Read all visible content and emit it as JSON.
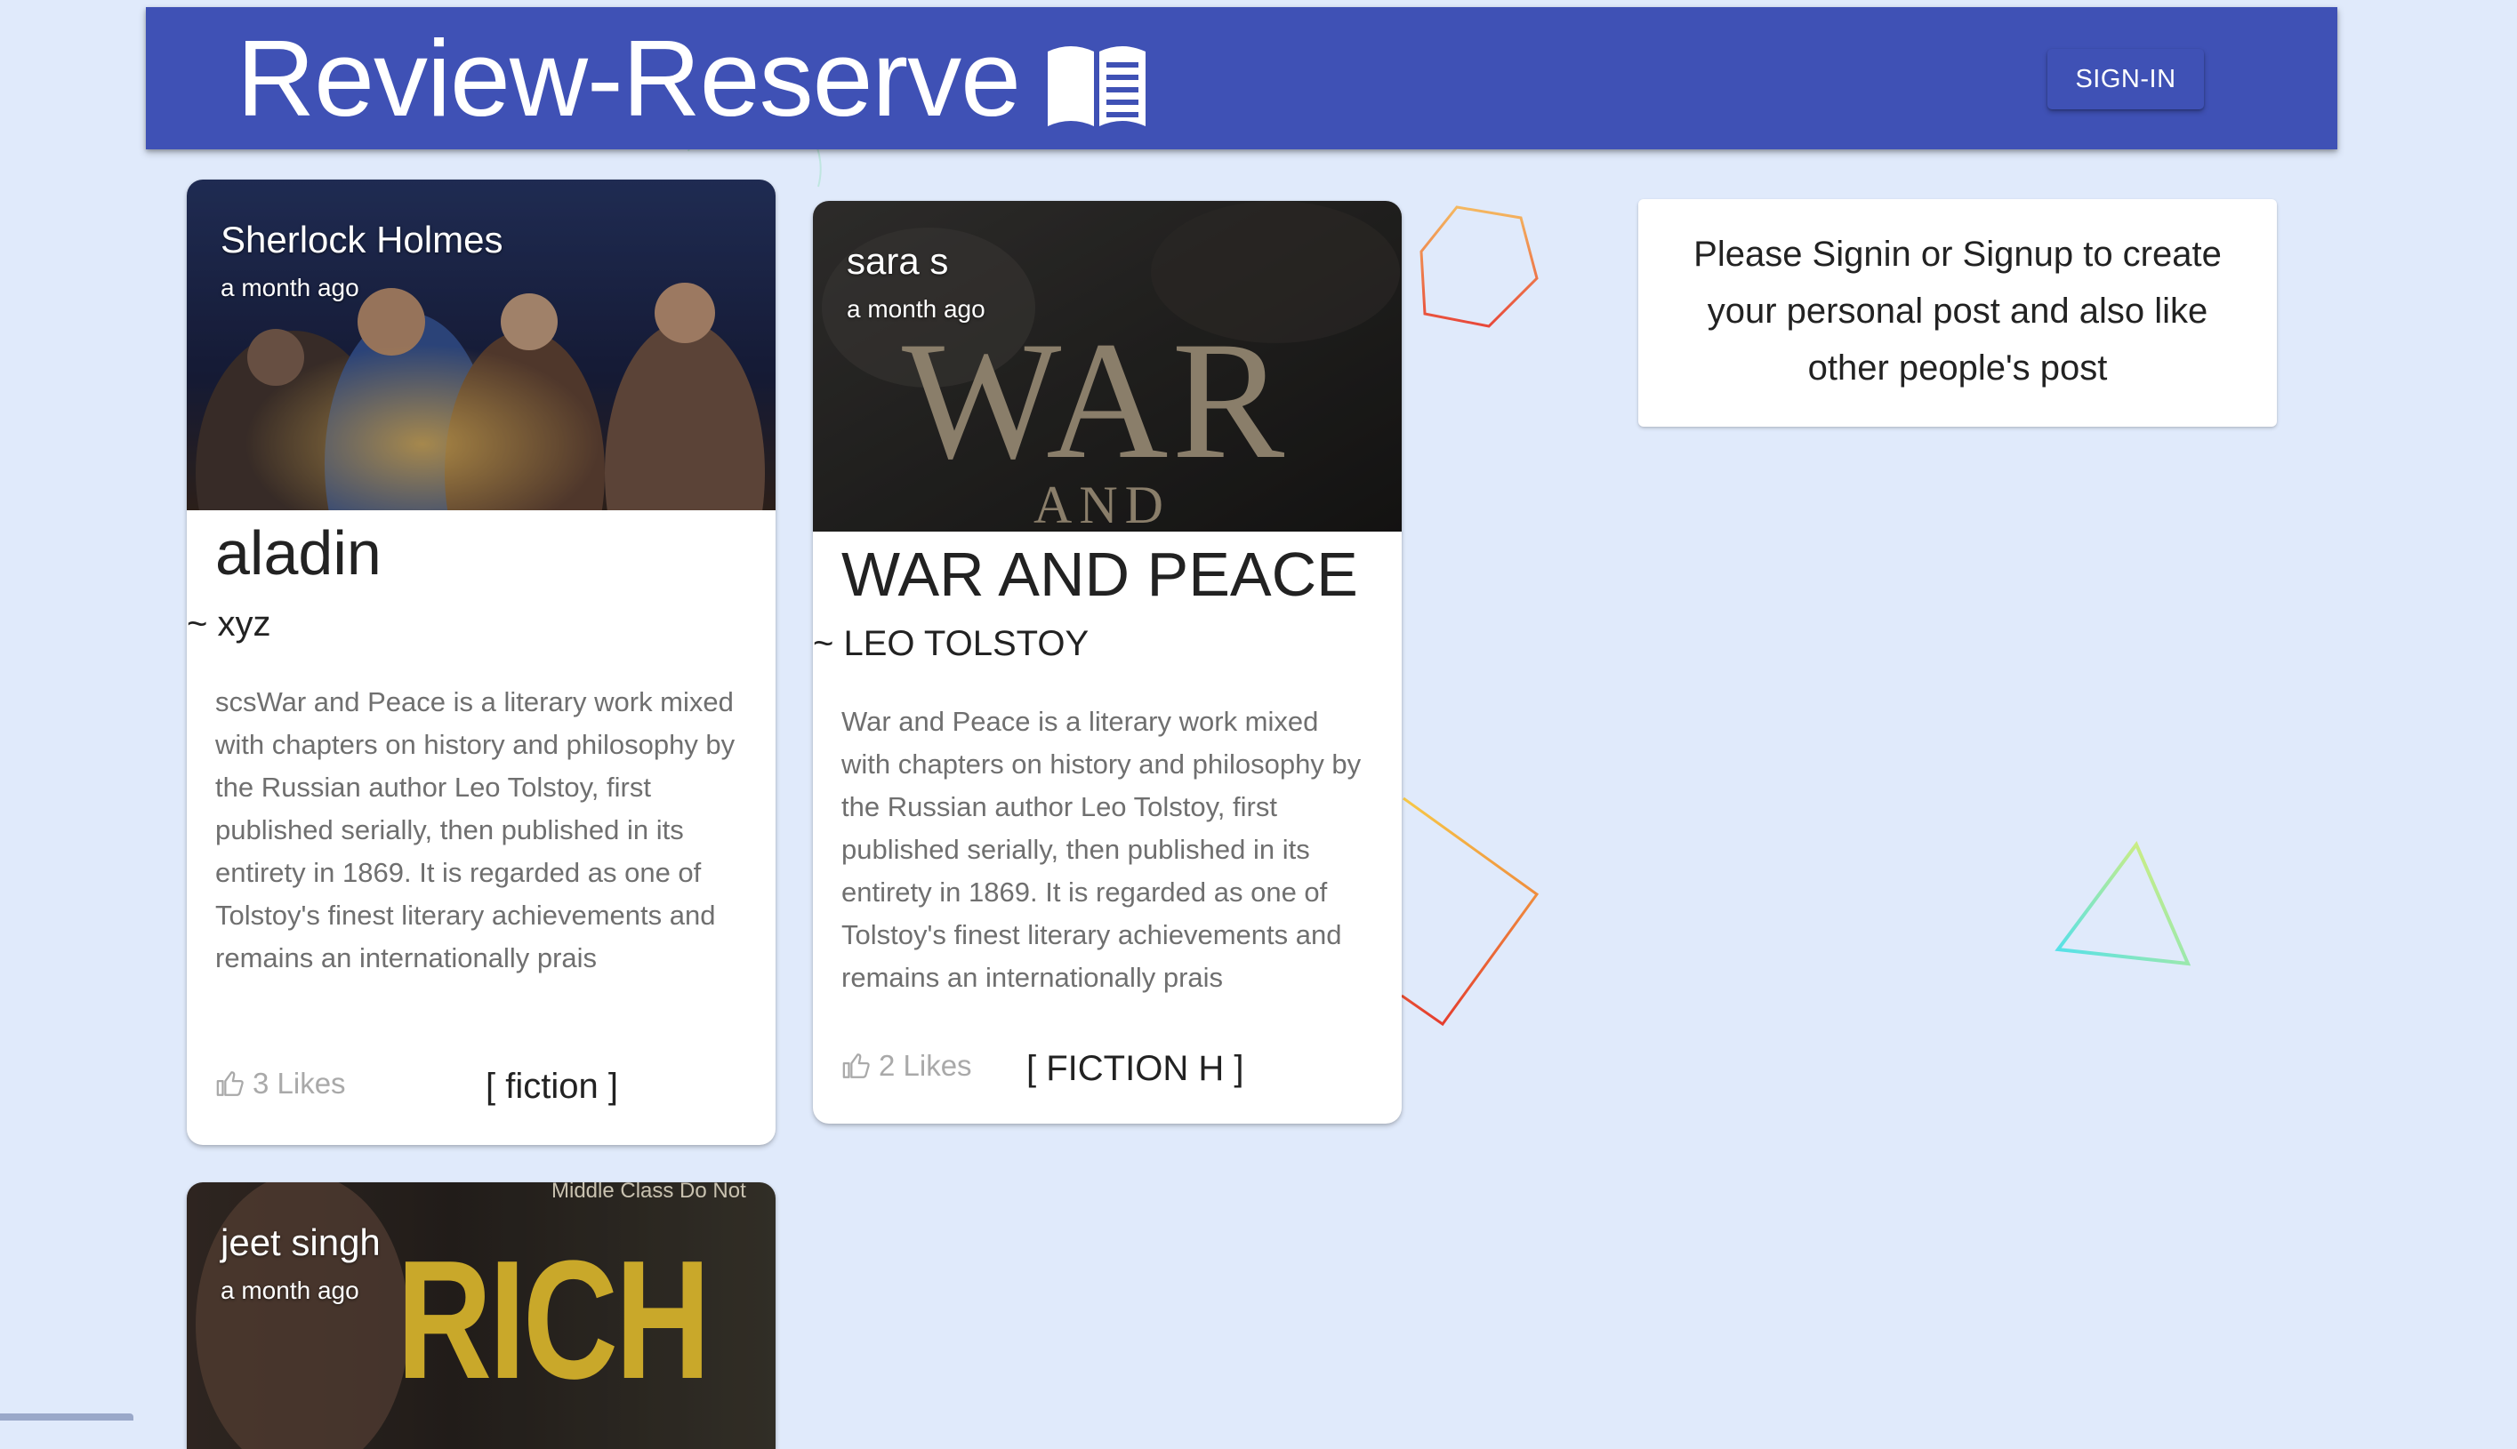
{
  "header": {
    "title": "Review-Reserve",
    "book_icon": "open-book-icon",
    "signin_label": "SIGN-IN",
    "background": "#3f51b5"
  },
  "posts": [
    {
      "author": "Sherlock Holmes",
      "time": "a month ago",
      "title": "aladin",
      "book_author": "~ xyz",
      "excerpt": "scsWar and Peace is a literary work mixed with chapters on history and philosophy by the Russian author Leo Tolstoy, first published serially, then published in its entirety in 1869. It is regarded as one of Tolstoy's finest literary achievements and remains an internationally prais",
      "likes": "3 Likes",
      "genre": "[ fiction ]"
    },
    {
      "author": "sara s",
      "time": "a month ago",
      "cover_text_1": "WAR",
      "cover_text_2": "AND",
      "title": "WAR AND PEACE",
      "book_author": "~ LEO TOLSTOY",
      "excerpt": "War and Peace is a literary work mixed with chapters on history and philosophy by the Russian author Leo Tolstoy, first published serially, then published in its entirety in 1869. It is regarded as one of Tolstoy's finest literary achievements and remains an internationally prais",
      "likes": "2 Likes",
      "genre": "[ FICTION H ]"
    },
    {
      "author": "jeet singh",
      "time": "a month ago",
      "cover_text_top": "Middle Class Do Not",
      "cover_text_big": "RICH"
    }
  ],
  "notice": {
    "text": "Please Signin or Signup to create your personal post and also like other people's post"
  },
  "colors": {
    "page_bg": "#e0eafb",
    "like_gray": "#a9a9a9"
  }
}
